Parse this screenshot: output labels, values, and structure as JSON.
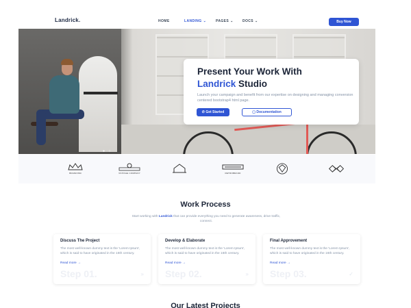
{
  "nav": {
    "logo": "Landrick.",
    "items": [
      {
        "label": "HOME",
        "active": false
      },
      {
        "label": "LANDING",
        "active": true
      },
      {
        "label": "PAGES",
        "active": false
      },
      {
        "label": "DOCS",
        "active": false
      }
    ],
    "cta": "Buy Now"
  },
  "hero": {
    "title_line1": "Present Your Work With",
    "title_accent": "Landrick",
    "title_rest": " Studio",
    "subtitle": "Launch your campaign and benefit from our expertise on designing and managing conversion centered bootstrap4 html page.",
    "primary_button": "Get Started",
    "secondary_button": "Documentation"
  },
  "partners": [
    {
      "name": "BRANDISM"
    },
    {
      "name": "VINTAGE COMPANY"
    },
    {
      "name": ""
    },
    {
      "name": "RETROBRAND"
    },
    {
      "name": ""
    },
    {
      "name": ""
    }
  ],
  "work_process": {
    "title": "Work Process",
    "subtitle_pre": "Start working with ",
    "subtitle_brand": "Landrick",
    "subtitle_post": " that can provide everything you need to generate awareness, drive traffic, connect.",
    "steps": [
      {
        "title": "Discuss The Project",
        "text": "The most well-known dummy text is the 'Lorem Ipsum', which is said to have originated in the 16th century.",
        "link": "Read more →",
        "num": "Step 01.",
        "icon": "»"
      },
      {
        "title": "Develop & Elaborate",
        "text": "The most well-known dummy text is the 'Lorem Ipsum', which is said to have originated in the 16th century.",
        "link": "Read more →",
        "num": "Step 02.",
        "icon": "»"
      },
      {
        "title": "Final Approvement",
        "text": "The most well-known dummy text is the 'Lorem Ipsum', which is said to have originated in the 16th century.",
        "link": "Read more →",
        "num": "Step 03.",
        "icon": "✓"
      }
    ]
  },
  "projects": {
    "title": "Our Latest Projects"
  },
  "colors": {
    "primary": "#2f55d4",
    "heading": "#1b2437",
    "muted": "#8492a6"
  }
}
